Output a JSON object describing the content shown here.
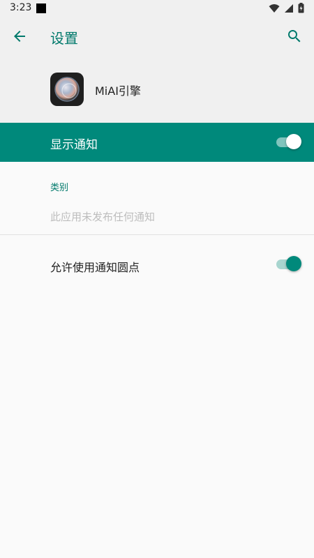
{
  "status_bar": {
    "time": "3:23"
  },
  "app_bar": {
    "title": "设置"
  },
  "app_info": {
    "name": "MiAI引擎"
  },
  "master_toggle": {
    "label": "显示通知",
    "checked": true
  },
  "category": {
    "header": "类别",
    "empty_message": "此应用未发布任何通知"
  },
  "notification_dot": {
    "label": "允许使用通知圆点",
    "checked": true
  },
  "colors": {
    "accent": "#00897b",
    "accent_dark": "#00796b"
  }
}
